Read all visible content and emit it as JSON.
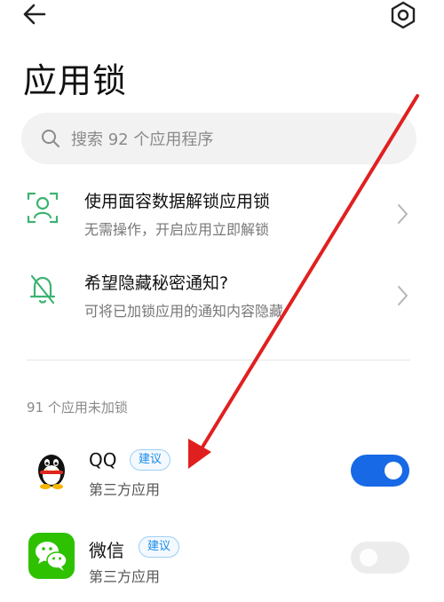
{
  "header": {
    "back_icon": "arrow-left-icon",
    "settings_icon": "gear-icon",
    "title": "应用锁"
  },
  "search": {
    "placeholder": "搜索 92 个应用程序"
  },
  "features": [
    {
      "icon": "face-scan-icon",
      "title": "使用面容数据解锁应用锁",
      "subtitle": "无需操作，开启应用立即解锁"
    },
    {
      "icon": "bell-off-icon",
      "title": "希望隐藏秘密通知?",
      "subtitle": "可将已加锁应用的通知内容隐藏"
    }
  ],
  "section": {
    "label": "91 个应用未加锁"
  },
  "apps": [
    {
      "name": "QQ",
      "badge": "建议",
      "type": "第三方应用",
      "locked": true,
      "icon": "qq-icon"
    },
    {
      "name": "微信",
      "badge": "建议",
      "type": "第三方应用",
      "locked": false,
      "icon": "wechat-icon"
    }
  ],
  "colors": {
    "accent": "#1769e6",
    "feature_icon": "#3cb371",
    "annotation_arrow": "#e02020"
  }
}
